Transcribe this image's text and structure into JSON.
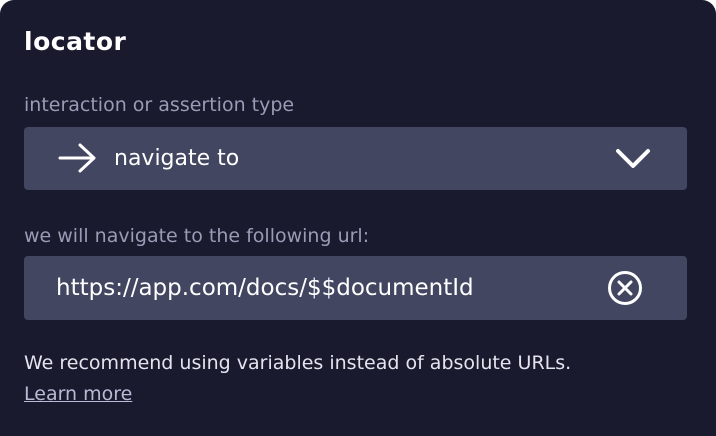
{
  "panel": {
    "title": "locator"
  },
  "interaction": {
    "label": "interaction or assertion type",
    "icon": "arrow-right-icon",
    "selected_value": "navigate to",
    "dropdown_icon": "chevron-down-icon"
  },
  "url": {
    "label": "we will navigate to the following url:",
    "value": "https://app.com/docs/$$documentId",
    "clear_icon": "circle-x-icon"
  },
  "hint": {
    "text": "We recommend using variables instead of absolute URLs.",
    "link_label": "Learn more"
  },
  "colors": {
    "background": "#191a2e",
    "field_background": "#424661",
    "label_text": "#9a9bb5",
    "text": "#ffffff"
  }
}
